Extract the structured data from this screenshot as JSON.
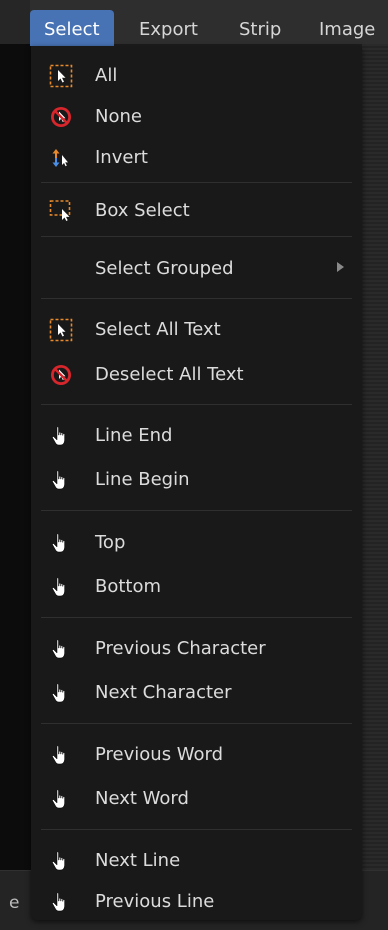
{
  "menubar": {
    "tabs": [
      {
        "label": "Select",
        "active": true
      },
      {
        "label": "Export",
        "active": false
      },
      {
        "label": "Strip",
        "active": false
      },
      {
        "label": "Image",
        "active": false
      }
    ]
  },
  "bottom_bar": {
    "edge_text": "e"
  },
  "menu": {
    "items": [
      {
        "label": "All",
        "icon": "select-all-icon"
      },
      {
        "label": "None",
        "icon": "select-none-icon"
      },
      {
        "label": "Invert",
        "icon": "select-invert-icon"
      },
      {
        "label": "Box Select",
        "icon": "box-select-icon"
      },
      {
        "label": "Select Grouped",
        "icon": "",
        "submenu": true
      },
      {
        "label": "Select All Text",
        "icon": "select-all-icon"
      },
      {
        "label": "Deselect All Text",
        "icon": "select-none-icon"
      },
      {
        "label": "Line End",
        "icon": "hand-icon"
      },
      {
        "label": "Line Begin",
        "icon": "hand-icon"
      },
      {
        "label": "Top",
        "icon": "hand-icon"
      },
      {
        "label": "Bottom",
        "icon": "hand-icon"
      },
      {
        "label": "Previous Character",
        "icon": "hand-icon"
      },
      {
        "label": "Next Character",
        "icon": "hand-icon"
      },
      {
        "label": "Previous Word",
        "icon": "hand-icon"
      },
      {
        "label": "Next Word",
        "icon": "hand-icon"
      },
      {
        "label": "Next Line",
        "icon": "hand-icon"
      },
      {
        "label": "Previous Line",
        "icon": "hand-icon"
      }
    ]
  },
  "colors": {
    "accent": "#4772b3",
    "menu_bg": "#191919",
    "text": "#dcdcdc",
    "dashed_orange": "#e8892b",
    "none_red": "#d7262c"
  }
}
